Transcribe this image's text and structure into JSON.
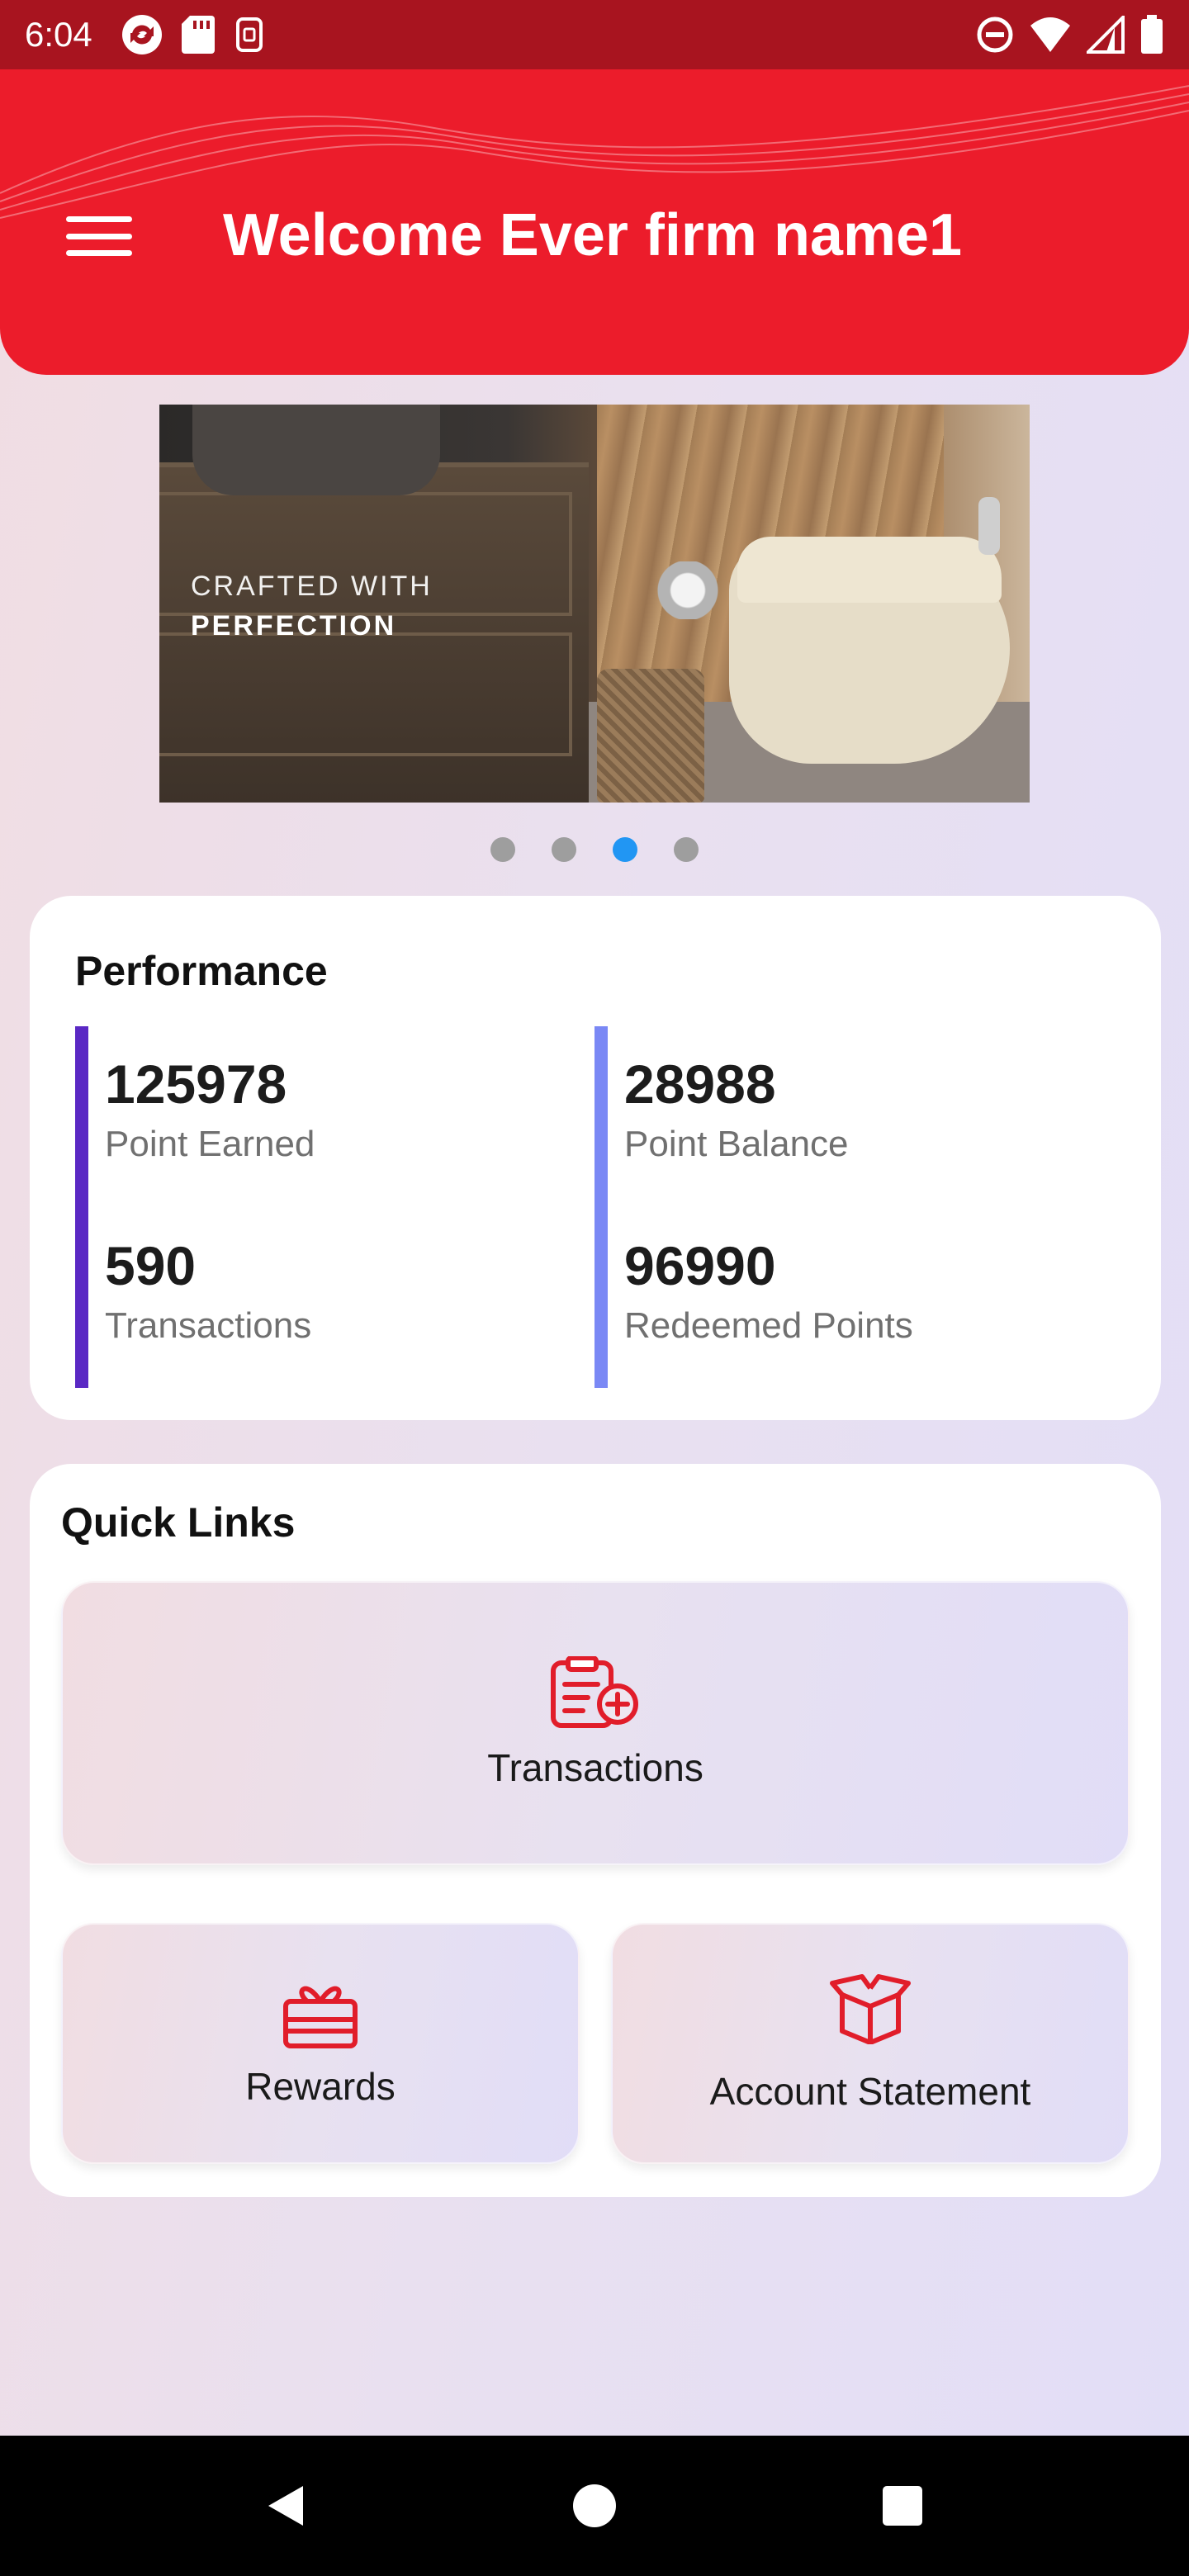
{
  "status_bar": {
    "time": "6:04",
    "left_icons": [
      "sync-icon",
      "sd-card-icon",
      "screenshot-icon"
    ],
    "right_icons": [
      "do-not-disturb-icon",
      "wifi-icon",
      "signal-icon",
      "battery-icon"
    ]
  },
  "header": {
    "title": "Welcome Ever firm name1",
    "menu_icon": "hamburger-menu-icon",
    "background_color": "#ec1c2b"
  },
  "banner": {
    "line1": "CRAFTED WITH",
    "line2": "PERFECTION",
    "slide_count": 4,
    "active_slide": 3
  },
  "performance": {
    "title": "Performance",
    "stats": {
      "point_earned": {
        "value": "125978",
        "label": "Point Earned"
      },
      "transactions": {
        "value": "590",
        "label": "Transactions"
      },
      "point_balance": {
        "value": "28988",
        "label": "Point Balance"
      },
      "redeemed_points": {
        "value": "96990",
        "label": "Redeemed Points"
      }
    },
    "accent_left": "#5a28c4",
    "accent_right": "#7a88f5"
  },
  "quick_links": {
    "title": "Quick Links",
    "items": [
      {
        "label": "Transactions",
        "icon": "transactions-icon"
      },
      {
        "label": "Rewards",
        "icon": "gift-icon"
      },
      {
        "label": "Account Statement",
        "icon": "box-icon"
      }
    ],
    "icon_color": "#e11d2a"
  },
  "nav_bar": {
    "buttons": [
      "back-icon",
      "home-icon",
      "recents-icon"
    ]
  }
}
